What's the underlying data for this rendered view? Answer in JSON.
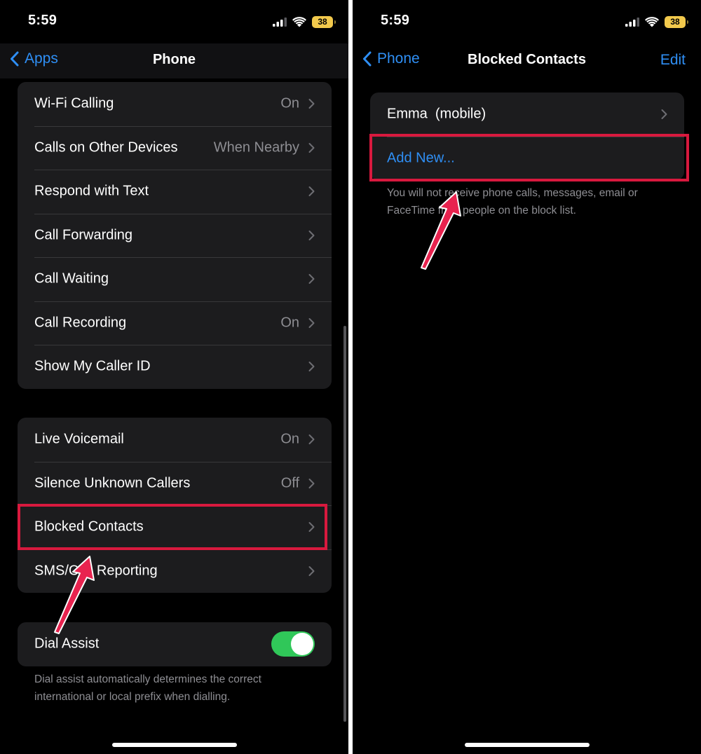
{
  "left": {
    "status": {
      "time": "5:59",
      "battery": "38"
    },
    "nav": {
      "back_label": "Apps",
      "title": "Phone"
    },
    "group1": {
      "rows": [
        {
          "label": "Wi-Fi Calling",
          "value": "On"
        },
        {
          "label": "Calls on Other Devices",
          "value": "When Nearby"
        },
        {
          "label": "Respond with Text",
          "value": ""
        },
        {
          "label": "Call Forwarding",
          "value": ""
        },
        {
          "label": "Call Waiting",
          "value": ""
        },
        {
          "label": "Call Recording",
          "value": "On"
        },
        {
          "label": "Show My Caller ID",
          "value": ""
        }
      ]
    },
    "group2": {
      "rows": [
        {
          "label": "Live Voicemail",
          "value": "On"
        },
        {
          "label": "Silence Unknown Callers",
          "value": "Off"
        },
        {
          "label": "Blocked Contacts",
          "value": ""
        },
        {
          "label": "SMS/Call Reporting",
          "value": ""
        }
      ]
    },
    "group3": {
      "label": "Dial Assist",
      "toggle_on": true
    },
    "dial_assist_footer": "Dial assist automatically determines the correct international or local prefix when dialling."
  },
  "right": {
    "status": {
      "time": "5:59",
      "battery": "38"
    },
    "nav": {
      "back_label": "Phone",
      "title": "Blocked Contacts",
      "action_label": "Edit"
    },
    "contacts": [
      {
        "label": "Emma  (mobile)"
      }
    ],
    "add_new_label": "Add New...",
    "footer": "You will not receive phone calls, messages, email or FaceTime from people on the block list."
  },
  "colors": {
    "accent": "#2f8ff5",
    "highlight": "#d8193e",
    "arrow": "#e8234f",
    "toggle_on": "#30c759",
    "cell_bg": "#1c1c1e",
    "secondary_text": "#8e8e93"
  },
  "icons": {
    "back": "chevron-left-icon",
    "disclosure": "chevron-right-icon",
    "signal": "cellular-signal-icon",
    "wifi": "wifi-icon",
    "battery": "battery-icon",
    "pointer": "arrow-pointer-icon"
  }
}
